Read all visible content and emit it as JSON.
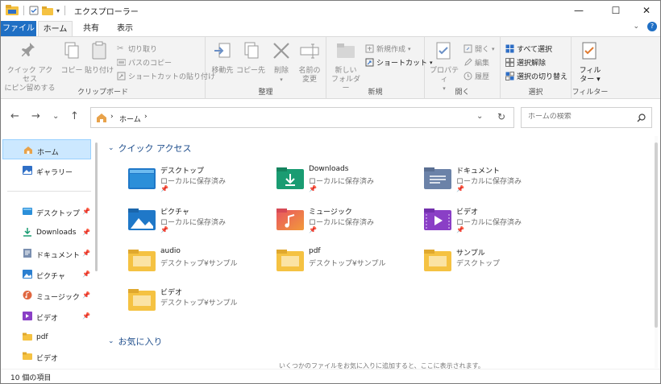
{
  "window": {
    "title": "エクスプローラー",
    "accent": "#1f6fc4"
  },
  "ribbon_tabs": [
    "ファイル",
    "ホーム",
    "共有",
    "表示"
  ],
  "ribbon": {
    "groups": {
      "clipboard": "クリップボード",
      "organize": "整理",
      "new": "新規",
      "open": "開く",
      "select": "選択",
      "filter": "フィルター"
    },
    "pin_quick_access": [
      "クイック アクセス",
      "にピン留めする"
    ],
    "copy": "コピー",
    "paste": "貼り付け",
    "cut": "切り取り",
    "copy_path": "パスのコピー",
    "paste_shortcut": "ショートカットの貼り付け",
    "move_to": "移動先",
    "copy_to": "コピー先",
    "delete": "削除",
    "rename": [
      "名前の",
      "変更"
    ],
    "new_folder": [
      "新しい",
      "フォルダー"
    ],
    "new_item": "新規作成",
    "shortcut": "ショートカット",
    "properties": "プロパティ",
    "open": "開く",
    "edit": "編集",
    "history": "履歴",
    "select_all": "すべて選択",
    "select_none": "選択解除",
    "invert_selection": "選択の切り替え",
    "filter": [
      "フィル",
      "ター"
    ]
  },
  "address": {
    "path": "ホーム",
    "search_placeholder": "ホームの検索"
  },
  "navpane": {
    "items": [
      {
        "label": "ホーム",
        "icon": "home-icon",
        "selected": true
      },
      {
        "label": "ギャラリー",
        "icon": "gallery-icon"
      },
      {
        "label": "デスクトップ",
        "icon": "desktop-folder-icon",
        "pinned": true
      },
      {
        "label": "Downloads",
        "icon": "download-icon",
        "pinned": true
      },
      {
        "label": "ドキュメント",
        "icon": "document-icon",
        "pinned": true
      },
      {
        "label": "ピクチャ",
        "icon": "picture-icon",
        "pinned": true
      },
      {
        "label": "ミュージック",
        "icon": "music-icon",
        "pinned": true
      },
      {
        "label": "ビデオ",
        "icon": "video-icon",
        "pinned": true
      },
      {
        "label": "pdf",
        "icon": "folder-icon"
      },
      {
        "label": "ビデオ",
        "icon": "folder-icon"
      }
    ]
  },
  "quick_access": {
    "header": "クイック アクセス",
    "items": [
      {
        "name": "デスクトップ",
        "sub": "ローカルに保存済み",
        "icon": "desktop-folder-icon",
        "pinned": true
      },
      {
        "name": "Downloads",
        "sub": "ローカルに保存済み",
        "icon": "downloads-folder-icon",
        "pinned": true
      },
      {
        "name": "ドキュメント",
        "sub": "ローカルに保存済み",
        "icon": "documents-folder-icon",
        "pinned": true
      },
      {
        "name": "ピクチャ",
        "sub": "ローカルに保存済み",
        "icon": "pictures-folder-icon",
        "pinned": true
      },
      {
        "name": "ミュージック",
        "sub": "ローカルに保存済み",
        "icon": "music-folder-icon",
        "pinned": true
      },
      {
        "name": "ビデオ",
        "sub": "ローカルに保存済み",
        "icon": "videos-folder-icon",
        "pinned": true
      },
      {
        "name": "audio",
        "sub": "デスクトップ¥サンプル",
        "icon": "folder-icon"
      },
      {
        "name": "pdf",
        "sub": "デスクトップ¥サンプル",
        "icon": "folder-icon"
      },
      {
        "name": "サンプル",
        "sub": "デスクトップ",
        "icon": "folder-icon"
      },
      {
        "name": "ビデオ",
        "sub": "デスクトップ¥サンプル",
        "icon": "folder-icon"
      }
    ]
  },
  "favorites": {
    "header": "お気に入り",
    "message": "いくつかのファイルをお気に入りに追加すると、ここに表示されます。"
  },
  "status": {
    "count": "10 個の項目"
  }
}
